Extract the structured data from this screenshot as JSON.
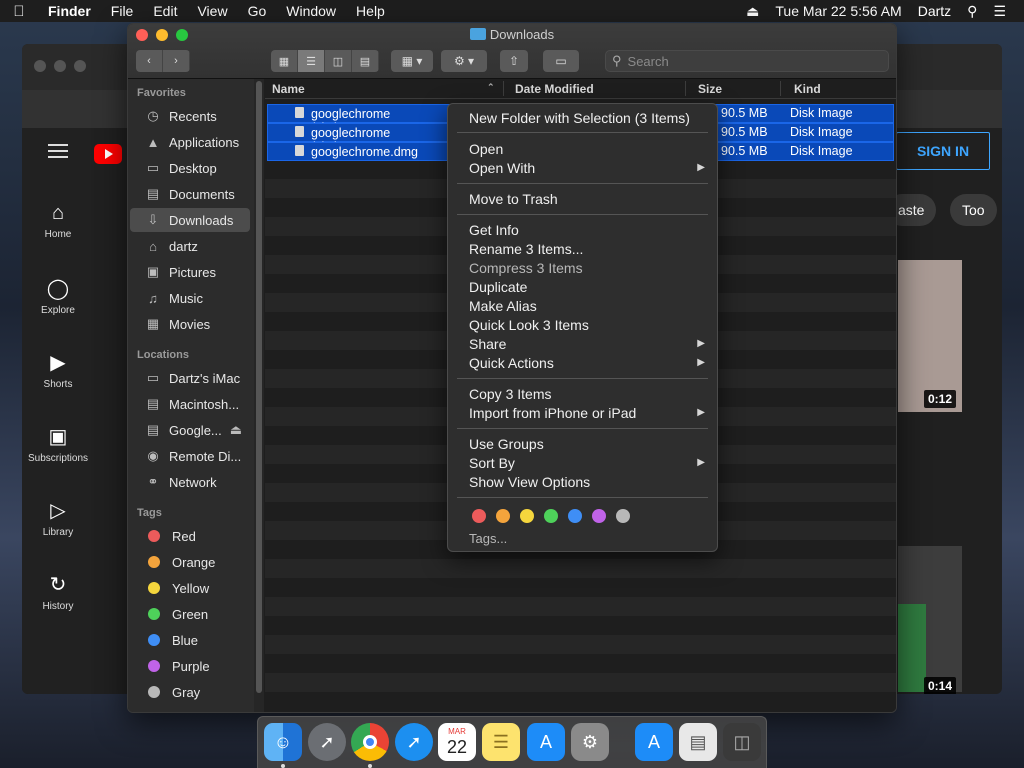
{
  "menubar": {
    "apple": "",
    "app": "Finder",
    "items": [
      "File",
      "Edit",
      "View",
      "Go",
      "Window",
      "Help"
    ],
    "clock": "Tue Mar 22  5:56 AM",
    "user": "Dartz"
  },
  "browser": {
    "signin": "SIGN IN",
    "chips": [
      "aste",
      "Too"
    ],
    "nav": [
      "Home",
      "Explore",
      "Shorts",
      "Subscriptions",
      "Library",
      "History"
    ],
    "durations": [
      "0:12",
      "0:14"
    ]
  },
  "finder": {
    "title": "Downloads",
    "search_placeholder": "Search",
    "sidebar": {
      "favorites_head": "Favorites",
      "favorites": [
        "Recents",
        "Applications",
        "Desktop",
        "Documents",
        "Downloads",
        "dartz",
        "Pictures",
        "Music",
        "Movies"
      ],
      "locations_head": "Locations",
      "locations": [
        "Dartz's iMac",
        "Macintosh...",
        "Google...",
        "Remote Di...",
        "Network"
      ],
      "tags_head": "Tags",
      "tags": [
        {
          "name": "Red",
          "color": "#ec5b5b"
        },
        {
          "name": "Orange",
          "color": "#f4a43c"
        },
        {
          "name": "Yellow",
          "color": "#f5d63d"
        },
        {
          "name": "Green",
          "color": "#4ed15a"
        },
        {
          "name": "Blue",
          "color": "#3f8ef5"
        },
        {
          "name": "Purple",
          "color": "#c063e8"
        },
        {
          "name": "Gray",
          "color": "#b8b8b8"
        }
      ]
    },
    "columns": {
      "name": "Name",
      "date": "Date Modified",
      "size": "Size",
      "kind": "Kind"
    },
    "files": [
      {
        "name": "googlechrome (1).dmg",
        "size": "90.5 MB",
        "kind": "Disk Image"
      },
      {
        "name": "googlechrome (2).dmg",
        "size": "90.5 MB",
        "kind": "Disk Image"
      },
      {
        "name": "googlechrome.dmg",
        "size": "90.5 MB",
        "kind": "Disk Image"
      }
    ]
  },
  "context_menu": {
    "new_folder": "New Folder with Selection (3 Items)",
    "open": "Open",
    "open_with": "Open With",
    "move_to_trash": "Move to Trash",
    "get_info": "Get Info",
    "rename": "Rename 3 Items...",
    "compress": "Compress 3 Items",
    "duplicate": "Duplicate",
    "make_alias": "Make Alias",
    "quick_look": "Quick Look 3 Items",
    "share": "Share",
    "quick_actions": "Quick Actions",
    "copy": "Copy 3 Items",
    "import": "Import from iPhone or iPad",
    "use_groups": "Use Groups",
    "sort_by": "Sort By",
    "view_options": "Show View Options",
    "tag_colors": [
      "#ec5b5b",
      "#f4a43c",
      "#f5d63d",
      "#4ed15a",
      "#3f8ef5",
      "#c063e8",
      "#b8b8b8"
    ],
    "tags": "Tags..."
  },
  "dock": {
    "calendar_month": "MAR",
    "calendar_day": "22"
  }
}
